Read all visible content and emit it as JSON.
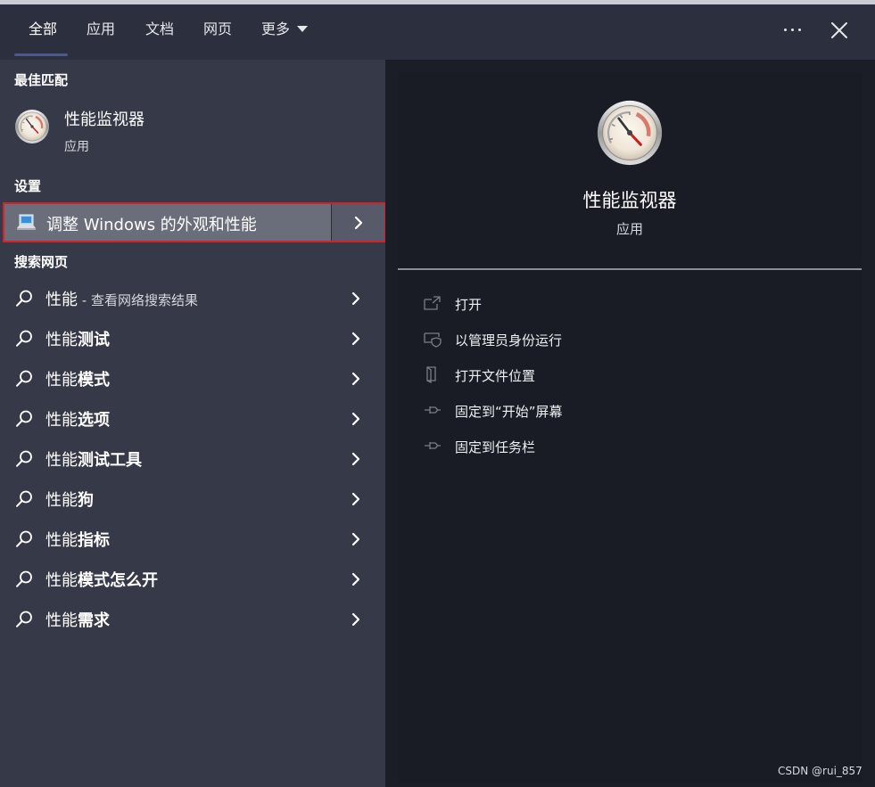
{
  "tabs": [
    {
      "label": "全部",
      "active": true
    },
    {
      "label": "应用"
    },
    {
      "label": "文档"
    },
    {
      "label": "网页"
    },
    {
      "label": "更多"
    }
  ],
  "best_match": {
    "heading": "最佳匹配",
    "title": "性能监视器",
    "subtitle": "应用",
    "icon": "performance-monitor-gauge-icon"
  },
  "settings": {
    "heading": "设置",
    "item": {
      "label": "调整 Windows 的外观和性能",
      "icon": "laptop-settings-icon",
      "highlight_color": "#d8202a"
    }
  },
  "web_search": {
    "heading": "搜索网页",
    "items": [
      {
        "prefix": "性能",
        "bold": "",
        "suffix": " - 查看网络搜索结果"
      },
      {
        "prefix": "性能",
        "bold": "测试",
        "suffix": ""
      },
      {
        "prefix": "性能",
        "bold": "模式",
        "suffix": ""
      },
      {
        "prefix": "性能",
        "bold": "选项",
        "suffix": ""
      },
      {
        "prefix": "性能",
        "bold": "测试工具",
        "suffix": ""
      },
      {
        "prefix": "性能",
        "bold": "狗",
        "suffix": ""
      },
      {
        "prefix": "性能",
        "bold": "指标",
        "suffix": ""
      },
      {
        "prefix": "性能",
        "bold": "模式怎么开",
        "suffix": ""
      },
      {
        "prefix": "性能",
        "bold": "需求",
        "suffix": ""
      }
    ]
  },
  "detail": {
    "title": "性能监视器",
    "subtitle": "应用",
    "actions": [
      {
        "label": "打开",
        "icon": "open-external-icon"
      },
      {
        "label": "以管理员身份运行",
        "icon": "shield-admin-icon"
      },
      {
        "label": "打开文件位置",
        "icon": "file-location-icon"
      },
      {
        "label": "固定到“开始”屏幕",
        "icon": "pin-start-icon"
      },
      {
        "label": "固定到任务栏",
        "icon": "pin-taskbar-icon"
      }
    ]
  },
  "watermark": "CSDN @rui_857"
}
